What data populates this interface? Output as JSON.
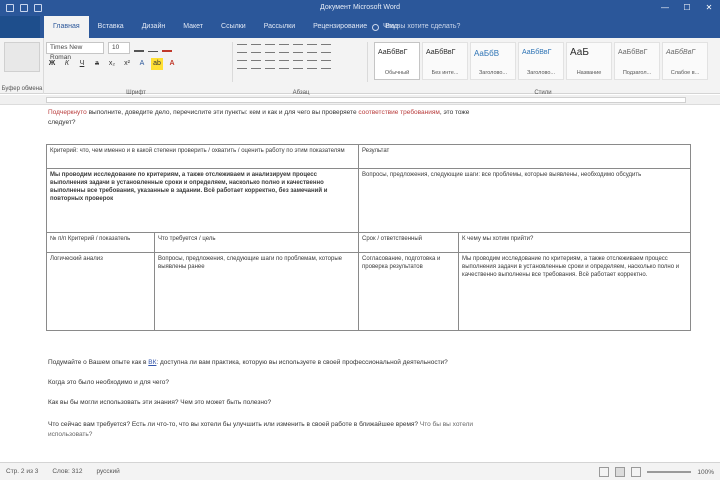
{
  "app": {
    "title": "Документ Microsoft Word",
    "window_controls": [
      "—",
      "☐",
      "✕"
    ]
  },
  "tabs": {
    "file": "",
    "items": [
      "Главная",
      "Вставка",
      "Дизайн",
      "Макет",
      "Ссылки",
      "Рассылки",
      "Рецензирование",
      "Вид"
    ],
    "active_index": 0,
    "tell_me": "Что вы хотите сделать?"
  },
  "ribbon": {
    "font_name": "Times New Roman",
    "font_size": "10",
    "group_labels": [
      "Буфер обмена",
      "Шрифт",
      "Абзац",
      "Стили"
    ],
    "styles": [
      {
        "sample": "АаБбВвГ",
        "name": "Обычный"
      },
      {
        "sample": "АаБбВвГ",
        "name": "Без инте..."
      },
      {
        "sample": "АаБбВ",
        "name": "Заголово..."
      },
      {
        "sample": "АаБбВвГ",
        "name": "Заголово..."
      },
      {
        "sample": "АаБ",
        "name": "Название"
      },
      {
        "sample": "АаБбВвГ",
        "name": "Подзагол..."
      },
      {
        "sample": "АаБбВвГ",
        "name": "Слабое в..."
      }
    ]
  },
  "document": {
    "top_line_marked": "Подчеркнуто",
    "top_line_text": " выполните, доведите дело, перечислите эти пункты: кем и как и для чего вы проверяете",
    "top_line_marked_end": " соответствие требованиям",
    "top_line_tail": ", это тоже",
    "top_line_2": "следует?",
    "table": {
      "r1": [
        "Критерий: что, чем именно и в какой степени проверить / охватить / оценить работу по этим показателям",
        "Результат"
      ],
      "r2": [
        "Мы проводим исследование по критериям, а также отслеживаем и анализируем процесс выполнения задачи в установленные сроки и определяем, насколько полно и качественно выполнены все требования, указанные в задании. Всё работает корректно, без замечаний и повторных проверок",
        "Вопросы, предложения, следующие шаги: все проблемы, которые выявлены, необходимо обсудить"
      ],
      "r3": [
        "№ п/п Критерий / показатель",
        "Что требуется / цель",
        "Срок / ответственный",
        "К чему мы хотим прийти?"
      ],
      "r4": [
        "Логический анализ",
        "Вопросы, предложения, следующие шаги по проблемам, которые выявлены ранее",
        "Согласование, подготовка и проверка результатов",
        "Мы проводим исследование по критериям, а также отслеживаем процесс выполнения задачи в установленные сроки и определяем, насколько полно и качественно выполнены все требования. Всё работает корректно."
      ]
    },
    "q1_pre": "Подумайте о Вашем опыте как в",
    "q1_link": "ВК",
    "q1_post": ": доступна ли вам практика, которую вы используете в своей профессиональной деятельности?",
    "q2": "Когда это было необходимо и для чего?",
    "q3": "Как вы бы могли использовать эти знания? Чем это может быть полезно?",
    "q4": "Что сейчас вам требуется? Есть ли что-то, что вы хотели бы улучшить или изменить в своей работе в ближайшее время?",
    "q4_tail": " Что бы вы хотели",
    "q4_line2": "использовать?"
  },
  "status": {
    "page": "Стр. 2 из 3",
    "words": "Слов: 312",
    "language": "русский",
    "zoom": "100%"
  }
}
